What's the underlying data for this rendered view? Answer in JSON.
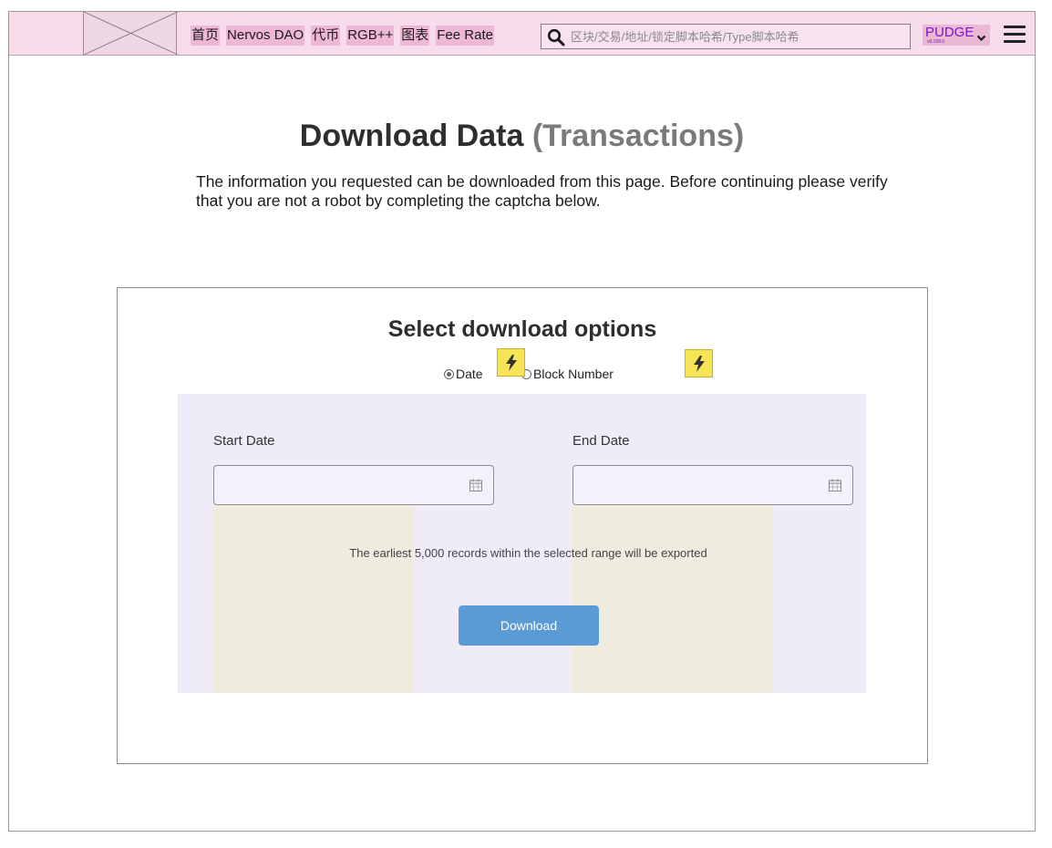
{
  "header": {
    "nav": [
      "首页",
      "Nervos DAO",
      "代币",
      "RGB++",
      "图表",
      "Fee Rate"
    ],
    "search_placeholder": "区块/交易/地址/锁定脚本哈希/Type脚本哈希",
    "network": {
      "name": "PUDGE",
      "version": "v0.108.0"
    }
  },
  "page": {
    "title": "Download Data",
    "title_sub": "(Transactions)",
    "intro": "The information you requested can be downloaded from this page. Before continuing please verify that you are not a robot by completing the captcha below."
  },
  "options": {
    "title": "Select download options",
    "radio_date": "Date",
    "radio_block": "Block Number",
    "selected": "Date",
    "start_label": "Start Date",
    "end_label": "End Date",
    "start_value": "",
    "end_value": "",
    "note": "The earliest 5,000 records within the selected range will be exported",
    "download_label": "Download"
  },
  "colors": {
    "header_bg": "#f7dceb",
    "nav_highlight": "#eeb7d6",
    "network_text": "#7a18c8",
    "button": "#5b9bd5",
    "panel_bg": "#efecf8",
    "bolt": "#f8e557"
  },
  "icons": [
    "logo-placeholder",
    "search-icon",
    "chevron-down-icon",
    "menu-icon",
    "bolt-icon",
    "calendar-icon"
  ]
}
